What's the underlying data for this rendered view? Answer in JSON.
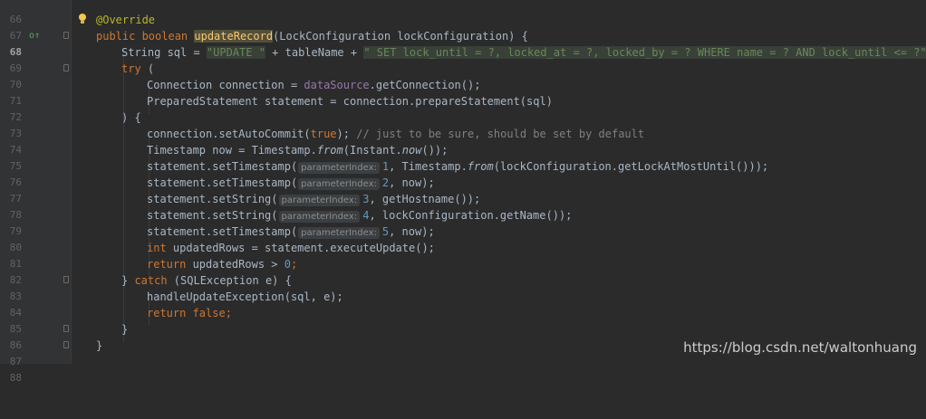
{
  "editor": {
    "lines": [
      {
        "num": "66"
      },
      {
        "num": "67",
        "annotation": "@Override"
      },
      {
        "num": "68",
        "active": true,
        "kw1": "public boolean ",
        "method": "updateRecord",
        "rest": "(LockConfiguration lockConfiguration) {"
      },
      {
        "num": "69",
        "a": "String sql = ",
        "s1": "\"UPDATE \"",
        "b": " + tableName + ",
        "s2": "\" SET lock_until = ?, locked_at = ?, locked_by = ? WHERE name = ? AND lock_until <= ?\"",
        "c": ";"
      },
      {
        "num": "70",
        "kw": "try",
        "rest": " ("
      },
      {
        "num": "71",
        "a": "Connection connection = ",
        "field": "dataSource",
        "rest": ".getConnection();"
      },
      {
        "num": "72",
        "text": "PreparedStatement statement = connection.prepareStatement(sql)"
      },
      {
        "num": "73",
        "text": ") {"
      },
      {
        "num": "74",
        "a": "connection.setAutoCommit(",
        "kw": "true",
        "b": "); ",
        "comment": "// just to be sure, should be set by default"
      },
      {
        "num": "75",
        "a": "Timestamp now = Timestamp.",
        "i1": "from",
        "b": "(Instant.",
        "i2": "now",
        "c": "());"
      },
      {
        "num": "76",
        "a": "statement.setTimestamp(",
        "hint": "parameterIndex:",
        "n": "1",
        "b": ", Timestamp.",
        "i1": "from",
        "c": "(lockConfiguration.getLockAtMostUntil()));"
      },
      {
        "num": "77",
        "a": "statement.setTimestamp(",
        "hint": "parameterIndex:",
        "n": "2",
        "b": ", now);"
      },
      {
        "num": "78",
        "a": "statement.setString(",
        "hint": "parameterIndex:",
        "n": "3",
        "b": ", getHostname());"
      },
      {
        "num": "79",
        "a": "statement.setString(",
        "hint": "parameterIndex:",
        "n": "4",
        "b": ", lockConfiguration.getName());"
      },
      {
        "num": "80",
        "a": "statement.setTimestamp(",
        "hint": "parameterIndex:",
        "n": "5",
        "b": ", now);"
      },
      {
        "num": "81",
        "kw": "int",
        "rest": " updatedRows = statement.executeUpdate();"
      },
      {
        "num": "82",
        "kw": "return",
        "a": " updatedRows > ",
        "n": "0",
        "b": ";"
      },
      {
        "num": "83",
        "a": "} ",
        "kw": "catch",
        "b": " (SQLException e) {"
      },
      {
        "num": "84",
        "text": "handleUpdateException(sql, e);"
      },
      {
        "num": "85",
        "kw": "return",
        "kw2": " false",
        "b": ";"
      },
      {
        "num": "86",
        "text": "}"
      },
      {
        "num": "87",
        "text": "}"
      },
      {
        "num": "88",
        "text": ""
      }
    ]
  },
  "watermark": "https://blog.csdn.net/waltonhuang",
  "colors": {
    "background": "#2b2b2b",
    "keyword": "#cc7832",
    "string": "#6a8759",
    "method": "#ffc66d",
    "field": "#9876aa",
    "number": "#6897bb",
    "comment": "#808080"
  }
}
